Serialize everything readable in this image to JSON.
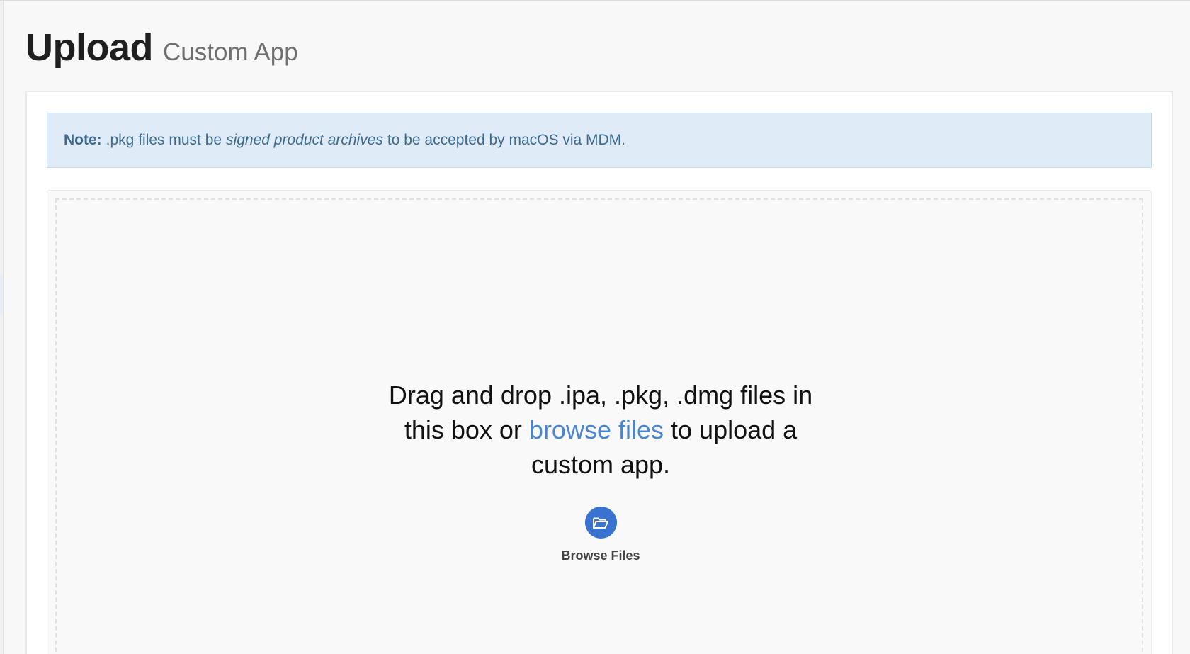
{
  "page": {
    "title": "Upload",
    "subtitle": "Custom App"
  },
  "note": {
    "label": "Note:",
    "text_before": ".pkg files must be",
    "emphasis": "signed product archives",
    "text_after": "to be accepted by macOS via MDM."
  },
  "dropzone": {
    "line1": "Drag and drop .ipa, .pkg, .dmg files in",
    "line2_before": "this box or",
    "line2_link": "browse files",
    "line2_after": "to upload a",
    "line3": "custom app.",
    "browse_button_label": "Browse Files",
    "browse_icon": "folder-open-icon"
  },
  "colors": {
    "accent": "#3a73cf",
    "link": "#4a85d2",
    "note_background": "#dfebf6",
    "note_text": "#3e6a8f"
  }
}
